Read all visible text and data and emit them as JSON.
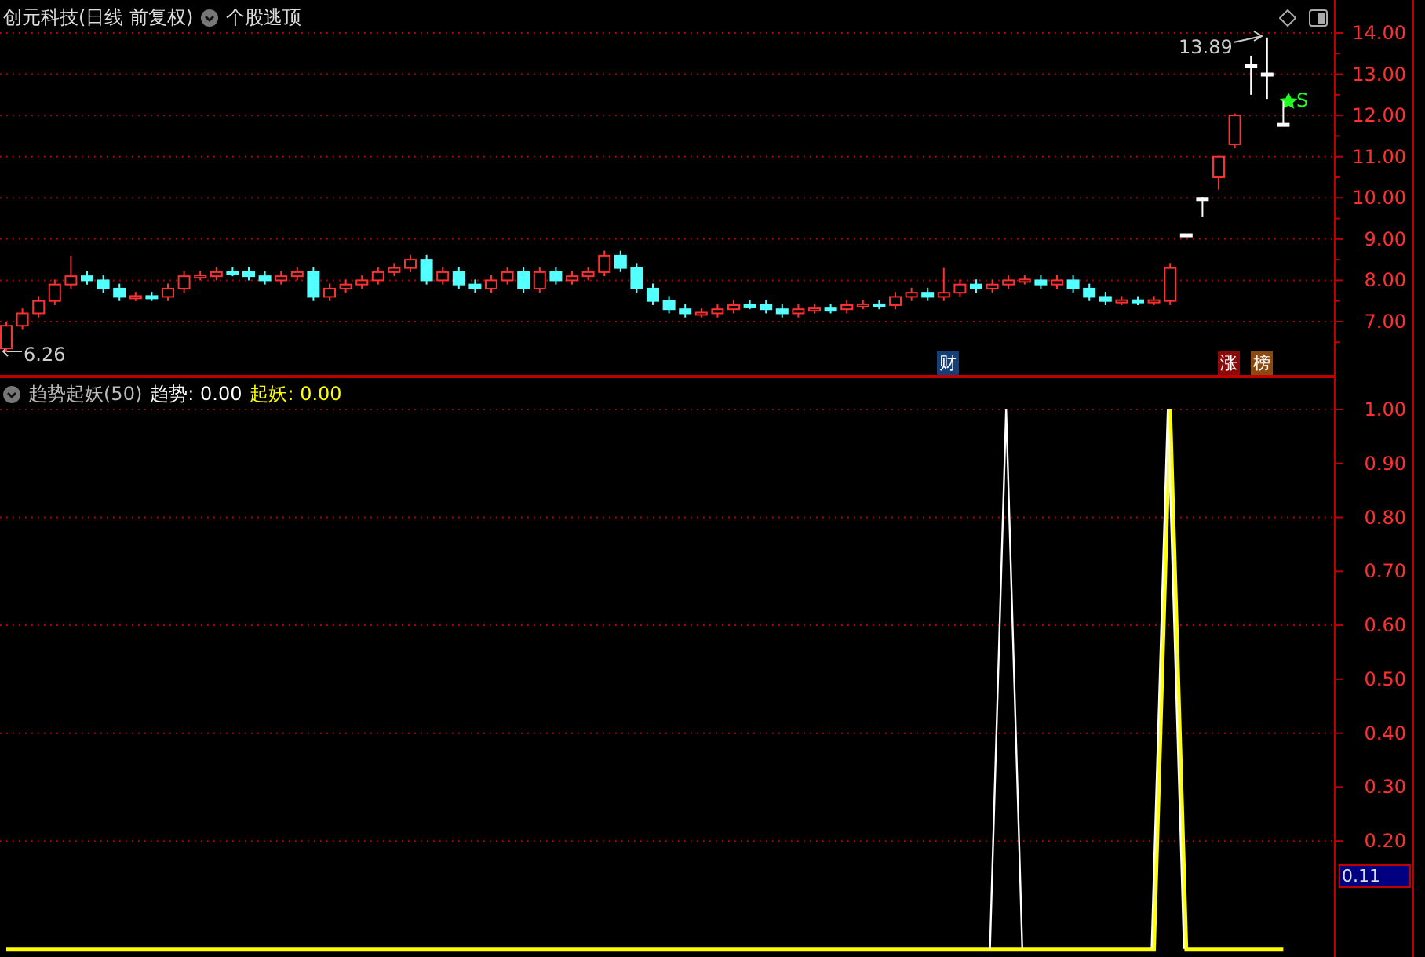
{
  "price_panel": {
    "title": "创元科技(日线 前复权)",
    "indicator_menu": "个股逃顶",
    "high_marker": "13.89",
    "low_marker": "6.26",
    "signal_marker": "S",
    "badges": [
      {
        "text": "财",
        "color": "#163e78"
      },
      {
        "text": "涨",
        "color": "#8a0a0a"
      },
      {
        "text": "榜",
        "color": "#8a4a10"
      }
    ],
    "chart_data": {
      "type": "candlestick",
      "grid": true,
      "ylim": [
        5.668,
        14.799
      ],
      "yticks": [
        {
          "value": 14,
          "label": "14.00"
        },
        {
          "value": 13,
          "label": "13.00"
        },
        {
          "value": 12,
          "label": "12.00"
        },
        {
          "value": 11,
          "label": "11.00"
        },
        {
          "value": 10,
          "label": "10.00"
        },
        {
          "value": 9,
          "label": "9.00"
        },
        {
          "value": 8,
          "label": "8.00"
        },
        {
          "value": 7,
          "label": "7.00"
        }
      ],
      "ohlc": [
        [
          6.35,
          7.0,
          6.26,
          6.9
        ],
        [
          6.9,
          7.32,
          6.8,
          7.2
        ],
        [
          7.2,
          7.62,
          7.1,
          7.5
        ],
        [
          7.5,
          8.02,
          7.4,
          7.9
        ],
        [
          7.9,
          8.6,
          7.8,
          8.1
        ],
        [
          8.1,
          8.22,
          7.9,
          8.0
        ],
        [
          8.0,
          8.12,
          7.7,
          7.8
        ],
        [
          7.8,
          7.92,
          7.5,
          7.6
        ],
        [
          7.6,
          7.72,
          7.5,
          7.62
        ],
        [
          7.62,
          7.72,
          7.5,
          7.6
        ],
        [
          7.6,
          7.92,
          7.5,
          7.8
        ],
        [
          7.8,
          8.22,
          7.7,
          8.1
        ],
        [
          8.1,
          8.22,
          8.0,
          8.12
        ],
        [
          8.1,
          8.32,
          8.0,
          8.2
        ],
        [
          8.2,
          8.32,
          8.1,
          8.18
        ],
        [
          8.2,
          8.32,
          8.0,
          8.1
        ],
        [
          8.1,
          8.22,
          7.9,
          8.0
        ],
        [
          8.0,
          8.22,
          7.9,
          8.1
        ],
        [
          8.1,
          8.32,
          8.0,
          8.2
        ],
        [
          8.2,
          8.32,
          7.5,
          7.6
        ],
        [
          7.6,
          7.92,
          7.5,
          7.8
        ],
        [
          7.8,
          8.02,
          7.7,
          7.9
        ],
        [
          7.9,
          8.12,
          7.8,
          8.0
        ],
        [
          8.0,
          8.32,
          7.9,
          8.2
        ],
        [
          8.2,
          8.42,
          8.1,
          8.3
        ],
        [
          8.3,
          8.62,
          8.2,
          8.5
        ],
        [
          8.5,
          8.62,
          7.9,
          8.0
        ],
        [
          8.0,
          8.32,
          7.9,
          8.2
        ],
        [
          8.2,
          8.32,
          7.8,
          7.9
        ],
        [
          7.9,
          8.02,
          7.7,
          7.8
        ],
        [
          7.8,
          8.12,
          7.7,
          8.0
        ],
        [
          8.0,
          8.32,
          7.9,
          8.2
        ],
        [
          8.2,
          8.32,
          7.7,
          7.8
        ],
        [
          7.8,
          8.32,
          7.7,
          8.2
        ],
        [
          8.2,
          8.32,
          7.9,
          8.0
        ],
        [
          8.0,
          8.22,
          7.9,
          8.1
        ],
        [
          8.1,
          8.32,
          8.0,
          8.2
        ],
        [
          8.2,
          8.72,
          8.1,
          8.6
        ],
        [
          8.6,
          8.72,
          8.2,
          8.3
        ],
        [
          8.3,
          8.42,
          7.7,
          7.8
        ],
        [
          7.8,
          7.92,
          7.4,
          7.5
        ],
        [
          7.5,
          7.62,
          7.2,
          7.3
        ],
        [
          7.3,
          7.42,
          7.1,
          7.2
        ],
        [
          7.2,
          7.32,
          7.1,
          7.22
        ],
        [
          7.2,
          7.42,
          7.1,
          7.3
        ],
        [
          7.3,
          7.52,
          7.2,
          7.4
        ],
        [
          7.4,
          7.52,
          7.3,
          7.38
        ],
        [
          7.4,
          7.52,
          7.2,
          7.3
        ],
        [
          7.3,
          7.42,
          7.1,
          7.2
        ],
        [
          7.2,
          7.42,
          7.1,
          7.3
        ],
        [
          7.3,
          7.42,
          7.2,
          7.32
        ],
        [
          7.32,
          7.42,
          7.2,
          7.3
        ],
        [
          7.3,
          7.52,
          7.2,
          7.4
        ],
        [
          7.4,
          7.52,
          7.3,
          7.42
        ],
        [
          7.42,
          7.52,
          7.3,
          7.4
        ],
        [
          7.4,
          7.72,
          7.3,
          7.6
        ],
        [
          7.6,
          7.82,
          7.5,
          7.7
        ],
        [
          7.7,
          7.82,
          7.5,
          7.6
        ],
        [
          7.6,
          8.3,
          7.5,
          7.7
        ],
        [
          7.7,
          8.02,
          7.6,
          7.9
        ],
        [
          7.9,
          8.02,
          7.7,
          7.8
        ],
        [
          7.8,
          8.02,
          7.7,
          7.9
        ],
        [
          7.9,
          8.12,
          7.8,
          8.0
        ],
        [
          8.0,
          8.12,
          7.9,
          8.02
        ],
        [
          8.0,
          8.12,
          7.8,
          7.9
        ],
        [
          7.9,
          8.12,
          7.8,
          8.0
        ],
        [
          8.0,
          8.12,
          7.7,
          7.8
        ],
        [
          7.8,
          7.92,
          7.5,
          7.6
        ],
        [
          7.6,
          7.72,
          7.4,
          7.5
        ],
        [
          7.5,
          7.62,
          7.4,
          7.52
        ],
        [
          7.52,
          7.62,
          7.4,
          7.5
        ],
        [
          7.5,
          7.62,
          7.4,
          7.52
        ],
        [
          7.5,
          8.42,
          7.4,
          8.3
        ],
        [
          9.08,
          9.13,
          9.07,
          9.12
        ],
        [
          9.98,
          10.02,
          9.55,
          10.0
        ],
        [
          10.5,
          11.02,
          10.2,
          11.0
        ],
        [
          11.3,
          12.05,
          11.2,
          12.0
        ],
        [
          13.22,
          13.45,
          12.5,
          13.18
        ],
        [
          13.02,
          13.89,
          12.4,
          12.98
        ],
        [
          11.8,
          12.35,
          11.75,
          11.75
        ]
      ]
    }
  },
  "indicator_panel": {
    "title": "趋势起妖(50)",
    "legend": [
      {
        "value": ": 0.00"
      },
      {
        "value": ": 0.00"
      }
    ],
    "cursor_value": "0.11",
    "chart_data": {
      "type": "line",
      "grid": true,
      "ylim": [
        -0.012,
        1.061
      ],
      "yticks": [
        {
          "value": 1,
          "label": "1.00"
        },
        {
          "value": 0.9,
          "label": "0.90"
        },
        {
          "value": 0.8,
          "label": "0.80"
        },
        {
          "value": 0.7,
          "label": "0.70"
        },
        {
          "value": 0.6,
          "label": "0.60"
        },
        {
          "value": 0.5,
          "label": "0.50"
        },
        {
          "value": 0.4,
          "label": "0.40"
        },
        {
          "value": 0.3,
          "label": "0.30"
        },
        {
          "value": 0.2,
          "label": "0.20"
        }
      ],
      "series": [
        {
          "name": "趋势",
          "color": "#ffffff",
          "values": [
            null,
            null,
            null,
            null,
            null,
            null,
            null,
            null,
            null,
            null,
            null,
            null,
            null,
            null,
            null,
            null,
            null,
            null,
            null,
            null,
            null,
            null,
            null,
            null,
            null,
            null,
            null,
            null,
            null,
            null,
            null,
            null,
            null,
            null,
            null,
            null,
            null,
            null,
            null,
            null,
            null,
            null,
            null,
            null,
            null,
            null,
            null,
            null,
            null,
            null,
            null,
            null,
            null,
            null,
            null,
            null,
            null,
            null,
            null,
            null,
            null,
            0,
            1,
            0,
            null,
            null,
            null,
            null,
            null,
            null,
            null,
            0,
            1,
            0,
            null,
            null,
            null,
            null,
            null,
            null
          ]
        },
        {
          "name": "起妖",
          "color": "#ffff00",
          "values": [
            0,
            0,
            0,
            0,
            0,
            0,
            0,
            0,
            0,
            0,
            0,
            0,
            0,
            0,
            0,
            0,
            0,
            0,
            0,
            0,
            0,
            0,
            0,
            0,
            0,
            0,
            0,
            0,
            0,
            0,
            0,
            0,
            0,
            0,
            0,
            0,
            0,
            0,
            0,
            0,
            0,
            0,
            0,
            0,
            0,
            0,
            0,
            0,
            0,
            0,
            0,
            0,
            0,
            0,
            0,
            0,
            0,
            0,
            0,
            0,
            0,
            0,
            0,
            0,
            0,
            0,
            0,
            0,
            0,
            0,
            0,
            0,
            1,
            0,
            0,
            0,
            0,
            0,
            0,
            0
          ]
        }
      ]
    }
  }
}
